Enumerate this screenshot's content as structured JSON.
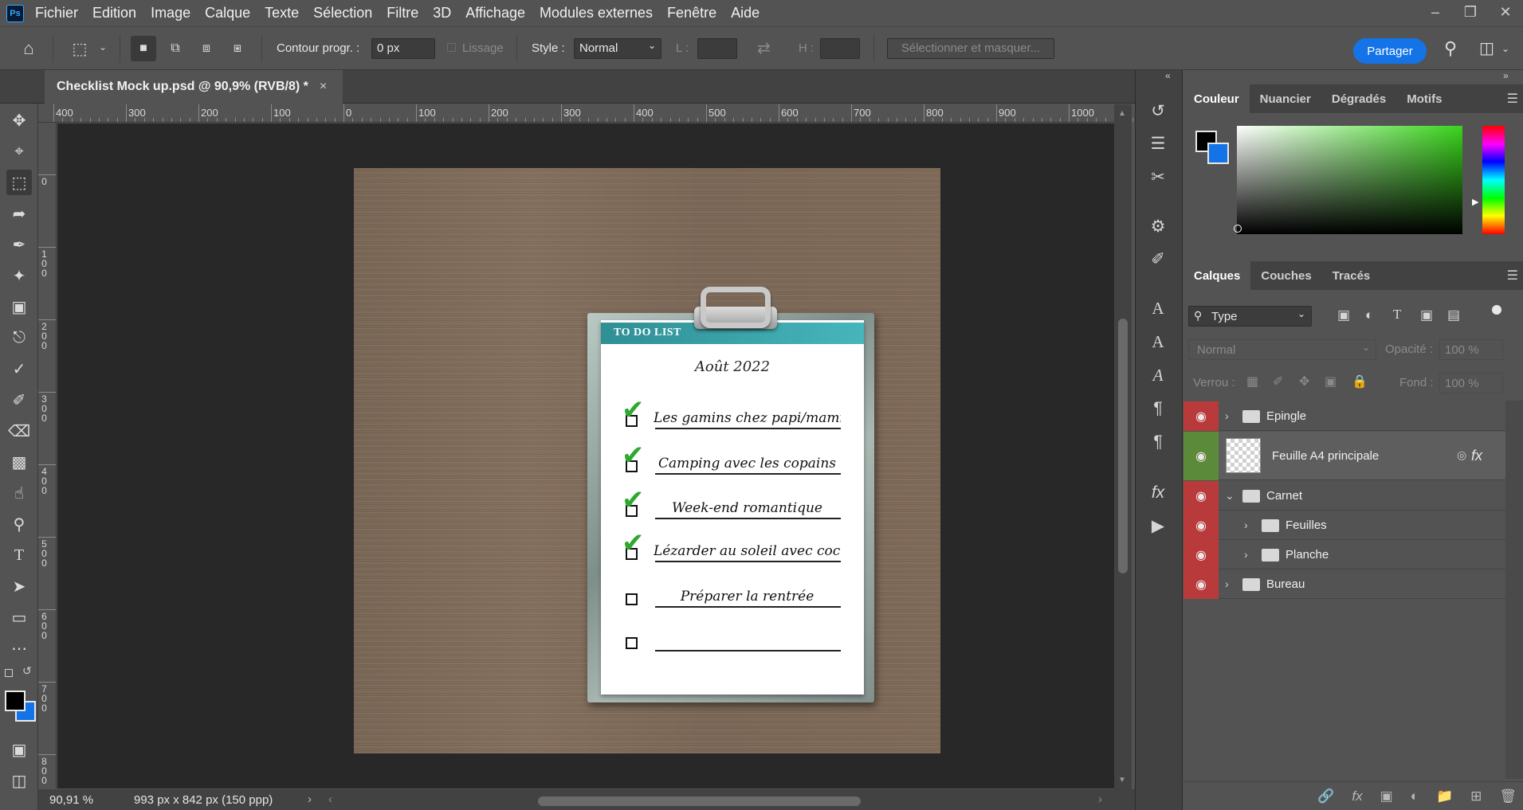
{
  "app": {
    "logo": "Ps"
  },
  "menu": [
    "Fichier",
    "Edition",
    "Image",
    "Calque",
    "Texte",
    "Sélection",
    "Filtre",
    "3D",
    "Affichage",
    "Modules externes",
    "Fenêtre",
    "Aide"
  ],
  "options": {
    "feather_label": "Contour progr. :",
    "feather_value": "0 px",
    "antialias_label": "Lissage",
    "style_label": "Style :",
    "style_value": "Normal",
    "w_label": "L :",
    "h_label": "H :",
    "select_mask": "Sélectionner et masquer...",
    "share": "Partager"
  },
  "document": {
    "tab_title": "Checklist Mock up.psd @ 90,9% (RVB/8) *",
    "close": "×"
  },
  "ruler_h": [
    "400",
    "300",
    "200",
    "100",
    "0",
    "100",
    "200",
    "300",
    "400",
    "500",
    "600",
    "700",
    "800",
    "900",
    "1000"
  ],
  "ruler_v": [
    "0",
    "100",
    "200",
    "300",
    "400",
    "500",
    "600",
    "700",
    "800"
  ],
  "mockup": {
    "header": "TO DO LIST",
    "date": "Août 2022",
    "tasks": [
      {
        "text": "Les gamins chez papi/mamie",
        "done": true
      },
      {
        "text": "Camping avec les copains",
        "done": true
      },
      {
        "text": "Week-end romantique",
        "done": true
      },
      {
        "text": "Lézarder au soleil avec cocktail",
        "done": true
      },
      {
        "text": "Préparer la rentrée",
        "done": false
      },
      {
        "text": "",
        "done": false
      }
    ]
  },
  "status": {
    "zoom": "90,91 %",
    "dimensions": "993 px x 842 px (150 ppp)"
  },
  "color_panel": {
    "tabs": [
      "Couleur",
      "Nuancier",
      "Dégradés",
      "Motifs"
    ],
    "foreground": "#000000",
    "background": "#1473e6"
  },
  "layers_panel": {
    "tabs": [
      "Calques",
      "Couches",
      "Tracés"
    ],
    "filter": "Type",
    "blend_mode": "Normal",
    "opacity_label": "Opacité :",
    "opacity_value": "100 %",
    "lock_label": "Verrou :",
    "fill_label": "Fond :",
    "fill_value": "100 %",
    "layers": [
      {
        "name": "Epingle",
        "type": "group",
        "indent": 0,
        "expanded": false
      },
      {
        "name": "Feuille A4 principale",
        "type": "smart-object",
        "indent": 0,
        "fx": "fx"
      },
      {
        "name": "Carnet",
        "type": "group",
        "indent": 0,
        "expanded": true
      },
      {
        "name": "Feuilles",
        "type": "group",
        "indent": 1,
        "expanded": false
      },
      {
        "name": "Planche",
        "type": "group",
        "indent": 1,
        "expanded": false
      },
      {
        "name": "Bureau",
        "type": "group",
        "indent": 0,
        "expanded": false
      }
    ]
  }
}
